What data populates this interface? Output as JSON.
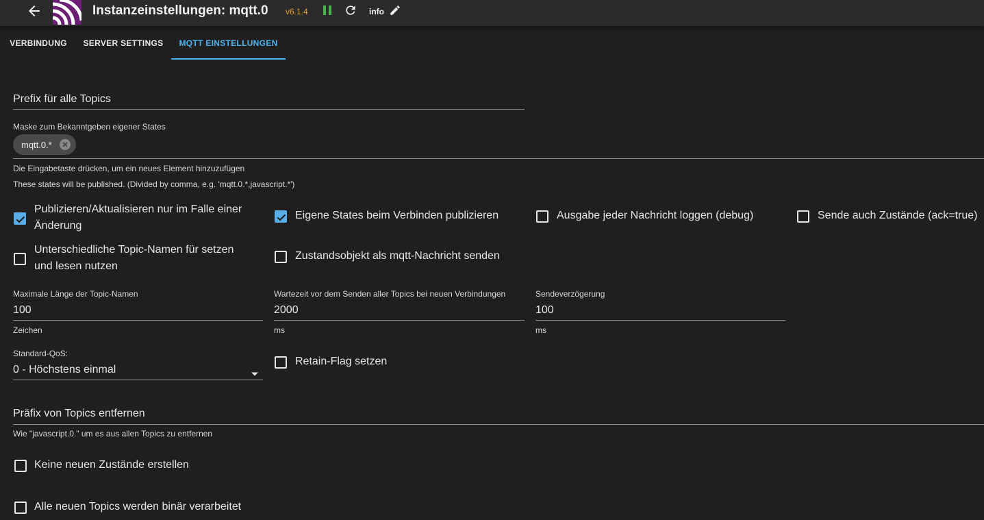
{
  "header": {
    "title": "Instanzeinstellungen: mqtt.0",
    "version": "v6.1.4",
    "info_label": "info",
    "colors": {
      "version": "#e09b2e",
      "pause": "#4caf50",
      "logo": "#6b1e73"
    }
  },
  "tabs": [
    {
      "label": "VERBINDUNG"
    },
    {
      "label": "SERVER SETTINGS"
    },
    {
      "label": "MQTT EINSTELLUNGEN",
      "active": true
    }
  ],
  "form": {
    "prefix": {
      "placeholder": "Prefix für alle Topics"
    },
    "mask": {
      "label": "Maske zum Bekanntgeben eigener States",
      "chip": "mqtt.0.*",
      "hint1": "Die Eingabetaste drücken, um ein neues Element hinzuzufügen",
      "hint2": "These states will be published. (Divided by comma, e.g. 'mqtt.0.*,javascript.*')"
    },
    "checkboxes": {
      "publish_on_change": {
        "label_line1": "Publizieren/Aktualisieren nur im Falle einer",
        "label_line2": "Änderung",
        "checked": true
      },
      "publish_own_states": {
        "label": "Eigene States beim Verbinden publizieren",
        "checked": true
      },
      "debug_log": {
        "label": "Ausgabe jeder Nachricht loggen (debug)",
        "checked": false
      },
      "send_ack": {
        "label": "Sende auch Zustände (ack=true)",
        "checked": false
      },
      "different_topic_names": {
        "label_line1": "Unterschiedliche Topic-Namen für setzen",
        "label_line2": "und lesen nutzen",
        "checked": false
      },
      "send_state_object": {
        "label": "Zustandsobjekt als mqtt-Nachricht senden",
        "checked": false
      },
      "retain_flag": {
        "label": "Retain-Flag setzen",
        "checked": false
      },
      "no_new_states": {
        "label": "Keine neuen Zustände erstellen",
        "checked": false
      },
      "binary_topics": {
        "label": "Alle neuen Topics werden binär verarbeitet",
        "checked": false
      }
    },
    "max_topic_length": {
      "label": "Maximale Länge der Topic-Namen",
      "value": "100",
      "unit": "Zeichen"
    },
    "wait_time": {
      "label": "Wartezeit vor dem Senden aller Topics bei neuen Verbindungen",
      "value": "2000",
      "unit": "ms"
    },
    "send_delay": {
      "label": "Sendeverzögerung",
      "value": "100",
      "unit": "ms"
    },
    "qos": {
      "label": "Standard-QoS:",
      "value": "0 - Höchstens einmal"
    },
    "remove_prefix": {
      "placeholder": "Präfix von Topics entfernen",
      "hint": "Wie \"javascript.0.\" um es aus allen Topics zu entfernen"
    }
  }
}
